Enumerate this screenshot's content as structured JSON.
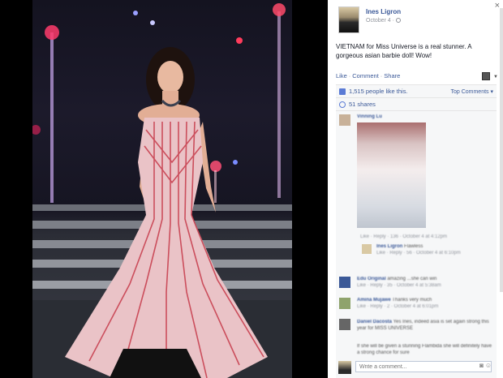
{
  "post": {
    "author": "Ines Ligron",
    "date": "October 4 · ",
    "text": "VIETNAM for Miss Universe is a real stunner. A gorgeous asian barbie doll! Wow!",
    "actions": {
      "like": "Like",
      "comment": "Comment",
      "share": "Share"
    },
    "likes": "1,515 people like this.",
    "top_comments": "Top Comments ▾",
    "shares": "51 shares",
    "close": "×"
  },
  "comments": [
    {
      "name": "Vinning Lu",
      "text": "",
      "meta": ""
    },
    {
      "name": "",
      "text": "",
      "meta": "Like · Reply · 136 · October 4 at 4:12pm"
    },
    {
      "name": "Ines Ligron",
      "text": "Flawless",
      "meta": "Like · Reply · 56 · October 4 at 6:10pm"
    },
    {
      "name": "Edu Original",
      "text": "amazing ...she can win",
      "meta": "Like · Reply · 35 · October 4 at 5:38am"
    },
    {
      "name": "Amina Mujawe",
      "text": "Thanks very much",
      "meta": "Like · Reply · 2 · October 4 at 6:01pm"
    },
    {
      "name": "Daniel Dacosta",
      "text": "Yes Ines, indeed asia is set again strong this year for MISS UNIVERSE",
      "meta": ""
    },
    {
      "name": "",
      "text": "If she will be given a stunning Flambida she will definitely have a strong chance for sure",
      "meta": ""
    }
  ],
  "write_comment": {
    "placeholder": "Write a comment..."
  }
}
